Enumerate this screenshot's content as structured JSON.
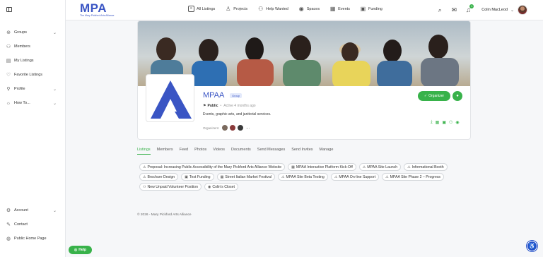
{
  "header": {
    "logo_text": "MPA",
    "logo_sub": "The Mary Pickford Arts Alliance",
    "nav": [
      {
        "label": "All Listings",
        "icon": "list-icon"
      },
      {
        "label": "Projects",
        "icon": "person-icon"
      },
      {
        "label": "Help Wanted",
        "icon": "person-add-icon"
      },
      {
        "label": "Spaces",
        "icon": "map-pin-icon"
      },
      {
        "label": "Events",
        "icon": "calendar-icon"
      },
      {
        "label": "Funding",
        "icon": "money-icon"
      }
    ],
    "notification_count": "1",
    "user_name": "Colin MacLeod"
  },
  "sidebar": {
    "items": [
      {
        "label": "Groups",
        "icon": "groups-icon",
        "has_chevron": true
      },
      {
        "label": "Members",
        "icon": "members-icon"
      },
      {
        "label": "My Listings",
        "icon": "listings-icon"
      },
      {
        "label": "Favorite Listings",
        "icon": "heart-icon"
      },
      {
        "label": "Profile",
        "icon": "profile-icon",
        "has_chevron": true
      },
      {
        "label": "How To...",
        "icon": "lightbulb-icon",
        "has_chevron": true
      }
    ],
    "bottom_items": [
      {
        "label": "Account",
        "icon": "gear-icon",
        "has_chevron": true
      },
      {
        "label": "Contact",
        "icon": "contact-icon"
      },
      {
        "label": "Public Home Page",
        "icon": "globe-icon"
      }
    ]
  },
  "group": {
    "name": "MPAA",
    "badge": "Group",
    "visibility": "Public",
    "active": "Active 4 months ago",
    "description": "Events, graphic arts, and janitorial services.",
    "organizers_label": "Organizers:",
    "organizers_more": "...",
    "organizer_button": "Organizer"
  },
  "tabs": [
    "Listings",
    "Members",
    "Feed",
    "Photos",
    "Videos",
    "Documents",
    "Send Messages",
    "Send Invites",
    "Manage"
  ],
  "listings": [
    {
      "label": "Proposal: Increasing Public Accessibility of the Mary Pickford Arts Alliance Website",
      "icon": "warning-icon"
    },
    {
      "label": "MPAA Interactive Platform Kick-Off",
      "icon": "calendar-icon"
    },
    {
      "label": "MPAA Site Launch",
      "icon": "warning-icon"
    },
    {
      "label": "Informational Booth",
      "icon": "warning-icon"
    },
    {
      "label": "Brochure Design",
      "icon": "warning-icon"
    },
    {
      "label": "Test Funding",
      "icon": "money-icon"
    },
    {
      "label": "Street Italian Market Festival",
      "icon": "calendar-icon"
    },
    {
      "label": "MPAA Site Beta Testing",
      "icon": "warning-icon"
    },
    {
      "label": "MPAA On-line Support",
      "icon": "warning-icon"
    },
    {
      "label": "MPAA Site Phase 2 – Progress",
      "icon": "warning-icon"
    },
    {
      "label": "New Unpaid Volunteer Position",
      "icon": "person-add-icon"
    },
    {
      "label": "Colin's Closet",
      "icon": "map-pin-icon"
    }
  ],
  "footer": "© 2026 - Mary Pickford Arts Alliance",
  "help_button": "Help",
  "colors": {
    "accent": "#38b24a",
    "brand": "#3a55c4"
  }
}
